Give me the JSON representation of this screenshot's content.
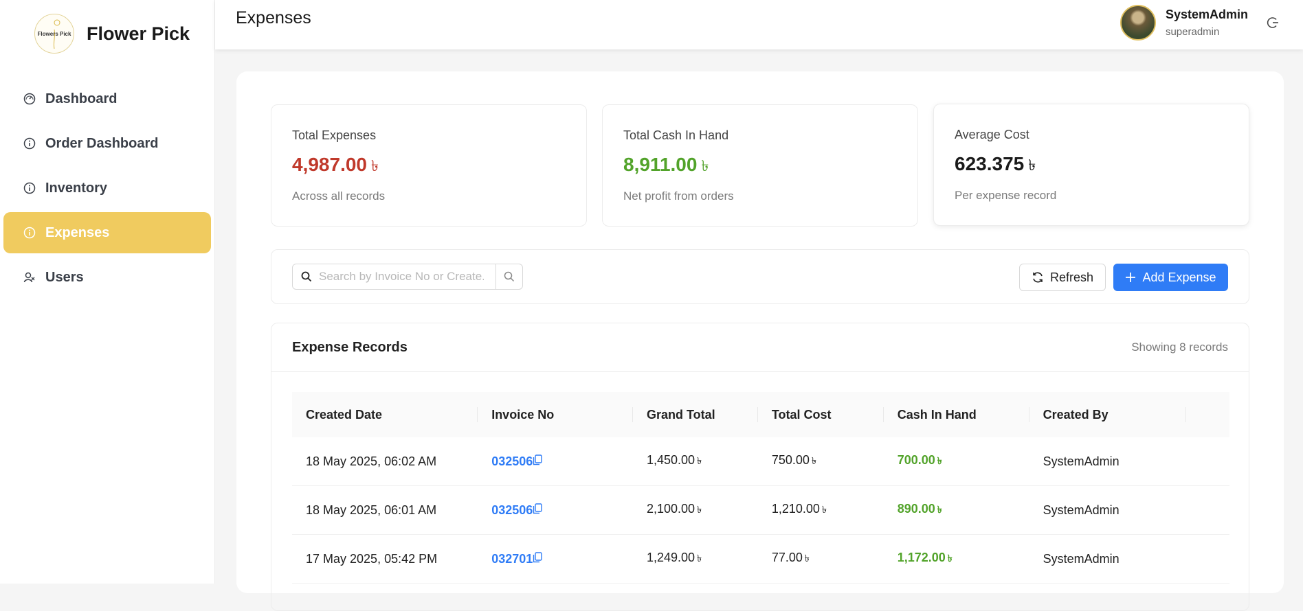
{
  "brand": {
    "name": "Flower Pick",
    "logo_text": "Flowers Pick"
  },
  "nav": [
    {
      "label": "Dashboard",
      "icon": "dashboard-icon"
    },
    {
      "label": "Order Dashboard",
      "icon": "info-icon"
    },
    {
      "label": "Inventory",
      "icon": "info-icon"
    },
    {
      "label": "Expenses",
      "icon": "info-icon",
      "active": true
    },
    {
      "label": "Users",
      "icon": "users-icon"
    }
  ],
  "header": {
    "title": "Expenses",
    "user_name": "SystemAdmin",
    "user_role": "superadmin"
  },
  "currency": "৳",
  "stats": [
    {
      "label": "Total Expenses",
      "value": "4,987.00",
      "sub": "Across all records",
      "color": "#c0392b"
    },
    {
      "label": "Total Cash In Hand",
      "value": "8,911.00",
      "sub": "Net profit from orders",
      "color": "#52a32a"
    },
    {
      "label": "Average Cost",
      "value": "623.375",
      "sub": "Per expense record",
      "color": "#1a1a1a"
    }
  ],
  "toolbar": {
    "search_placeholder": "Search by Invoice No or Create...",
    "refresh_label": "Refresh",
    "add_label": "Add Expense"
  },
  "records": {
    "title": "Expense Records",
    "count_text": "Showing 8 records",
    "columns": [
      "Created Date",
      "Invoice No",
      "Grand Total",
      "Total Cost",
      "Cash In Hand",
      "Created By"
    ],
    "rows": [
      {
        "date": "18 May 2025, 06:02 AM",
        "invoice": "032506",
        "grand": "1,450.00",
        "cost": "750.00",
        "cash": "700.00",
        "by": "SystemAdmin"
      },
      {
        "date": "18 May 2025, 06:01 AM",
        "invoice": "032506",
        "grand": "2,100.00",
        "cost": "1,210.00",
        "cash": "890.00",
        "by": "SystemAdmin"
      },
      {
        "date": "17 May 2025, 05:42 PM",
        "invoice": "032701",
        "grand": "1,249.00",
        "cost": "77.00",
        "cash": "1,172.00",
        "by": "SystemAdmin"
      }
    ]
  }
}
